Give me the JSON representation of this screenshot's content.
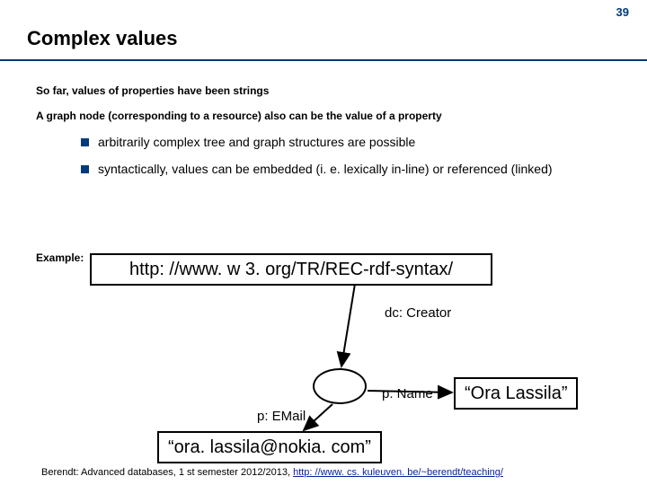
{
  "page_number": "39",
  "title": "Complex values",
  "line1": "So far, values of properties have been strings",
  "line2": "A graph node (corresponding to a resource) also can be the value of a property",
  "bullets": [
    "arbitrarily complex tree and graph structures are possible",
    "syntactically, values can be embedded (i. e. lexically in-line) or referenced (linked)"
  ],
  "example_label": "Example:",
  "graph": {
    "resource_url": "http: //www. w 3. org/TR/REC-rdf-syntax/",
    "edges": {
      "creator": "dc: Creator",
      "name": "p: Name",
      "email": "p: EMail"
    },
    "name_value": "“Ora Lassila”",
    "email_value": "“ora. lassila@nokia. com”"
  },
  "footer": {
    "prefix": "Berendt: Advanced databases, 1 st semester 2012/2013, ",
    "link": "http: //www. cs. kuleuven. be/~berendt/teaching/"
  }
}
